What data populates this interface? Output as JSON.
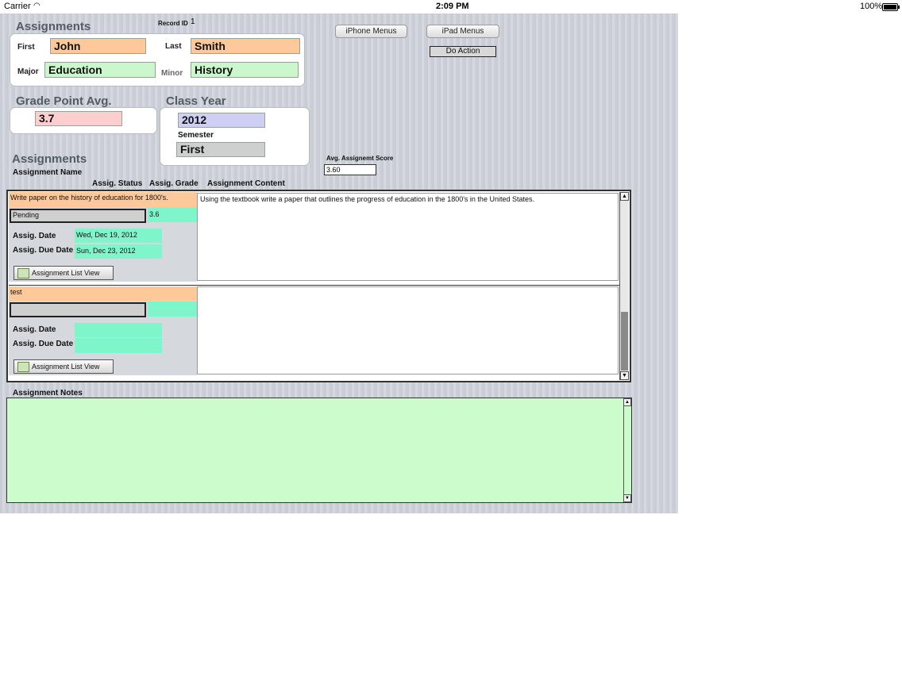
{
  "status_bar": {
    "carrier": "Carrier",
    "time": "2:09 PM",
    "battery": "100%"
  },
  "header": {
    "title": "Assignments",
    "record_id_label": "Record ID",
    "record_id": "1"
  },
  "student": {
    "first_label": "First",
    "first": "John",
    "last_label": "Last",
    "last": "Smith",
    "major_label": "Major",
    "major": "Education",
    "minor_label": "Minor",
    "minor": "History"
  },
  "gpa": {
    "label": "Grade Point Avg.",
    "value": "3.7"
  },
  "class_year": {
    "label": "Class Year",
    "value": "2012",
    "semester_label": "Semester",
    "semester": "First"
  },
  "buttons": {
    "iphone": "iPhone Menus",
    "ipad": "iPad Menus",
    "action": "Do Action"
  },
  "assignments": {
    "section_title": "Assignments",
    "name_label": "Assignment Name",
    "status_label": "Assig. Status",
    "grade_label": "Assig. Grade",
    "content_label": "Assignment Content",
    "avg_label": "Avg. Assignemt Score",
    "avg_value": "3.60",
    "date_label": "Assig. Date",
    "due_label": "Assig. Due Date",
    "list_view_label": "Assignment List View",
    "rows": [
      {
        "name": "Write paper on the history of education for 1800's.",
        "status": "Pending",
        "grade": "3.6",
        "date": "Wed, Dec 19, 2012",
        "due": "Sun, Dec 23, 2012",
        "content": "Using the textbook write a paper that outlines the progress of education in the 1800's in the United States."
      },
      {
        "name": "test",
        "status": "",
        "grade": "",
        "date": "",
        "due": "",
        "content": ""
      }
    ]
  },
  "notes": {
    "label": "Assignment Notes",
    "value": ""
  },
  "scroll_arrows": {
    "up": "▲",
    "down": "▼"
  }
}
